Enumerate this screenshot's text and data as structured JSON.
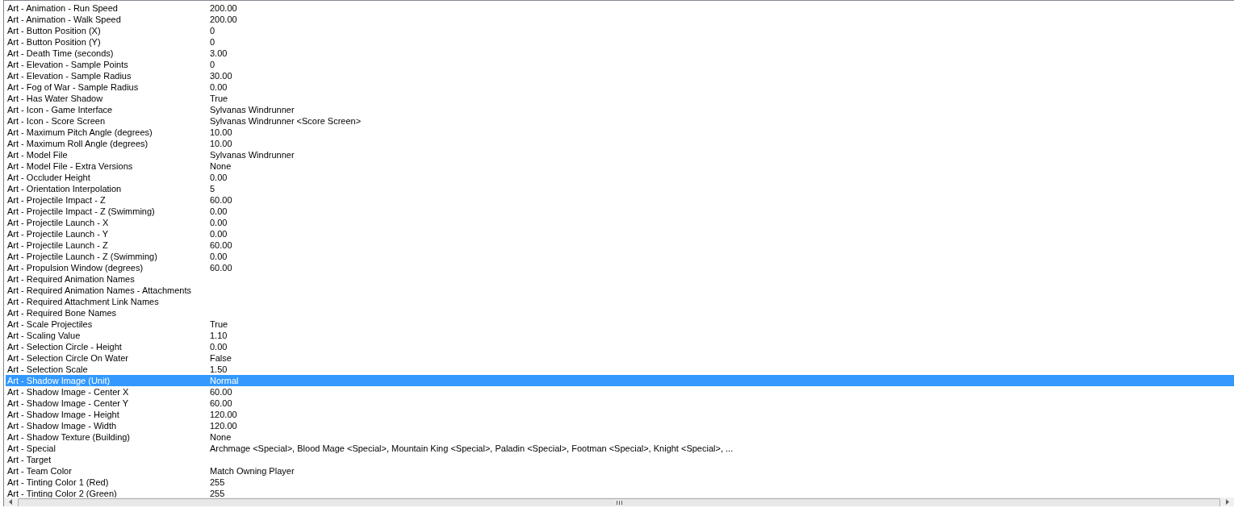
{
  "properties": [
    {
      "name": "Art - Animation - Run Speed",
      "value": "200.00",
      "selected": false
    },
    {
      "name": "Art - Animation - Walk Speed",
      "value": "200.00",
      "selected": false
    },
    {
      "name": "Art - Button Position (X)",
      "value": "0",
      "selected": false
    },
    {
      "name": "Art - Button Position (Y)",
      "value": "0",
      "selected": false
    },
    {
      "name": "Art - Death Time (seconds)",
      "value": "3.00",
      "selected": false
    },
    {
      "name": "Art - Elevation - Sample Points",
      "value": "0",
      "selected": false
    },
    {
      "name": "Art - Elevation - Sample Radius",
      "value": "30.00",
      "selected": false
    },
    {
      "name": "Art - Fog of War - Sample Radius",
      "value": "0.00",
      "selected": false
    },
    {
      "name": "Art - Has Water Shadow",
      "value": "True",
      "selected": false
    },
    {
      "name": "Art - Icon - Game Interface",
      "value": "Sylvanas Windrunner",
      "selected": false
    },
    {
      "name": "Art - Icon - Score Screen",
      "value": "Sylvanas Windrunner <Score Screen>",
      "selected": false
    },
    {
      "name": "Art - Maximum Pitch Angle (degrees)",
      "value": "10.00",
      "selected": false
    },
    {
      "name": "Art - Maximum Roll Angle (degrees)",
      "value": "10.00",
      "selected": false
    },
    {
      "name": "Art - Model File",
      "value": "Sylvanas Windrunner",
      "selected": false
    },
    {
      "name": "Art - Model File - Extra Versions",
      "value": "None",
      "selected": false
    },
    {
      "name": "Art - Occluder Height",
      "value": "0.00",
      "selected": false
    },
    {
      "name": "Art - Orientation Interpolation",
      "value": "5",
      "selected": false
    },
    {
      "name": "Art - Projectile Impact - Z",
      "value": "60.00",
      "selected": false
    },
    {
      "name": "Art - Projectile Impact - Z (Swimming)",
      "value": "0.00",
      "selected": false
    },
    {
      "name": "Art - Projectile Launch - X",
      "value": "0.00",
      "selected": false
    },
    {
      "name": "Art - Projectile Launch - Y",
      "value": "0.00",
      "selected": false
    },
    {
      "name": "Art - Projectile Launch - Z",
      "value": "60.00",
      "selected": false
    },
    {
      "name": "Art - Projectile Launch - Z (Swimming)",
      "value": "0.00",
      "selected": false
    },
    {
      "name": "Art - Propulsion Window (degrees)",
      "value": "60.00",
      "selected": false
    },
    {
      "name": "Art - Required Animation Names",
      "selected": false
    },
    {
      "name": "Art - Required Animation Names - Attachments",
      "selected": false
    },
    {
      "name": "Art - Required Attachment Link Names",
      "selected": false
    },
    {
      "name": "Art - Required Bone Names",
      "selected": false
    },
    {
      "name": "Art - Scale Projectiles",
      "value": "True",
      "selected": false
    },
    {
      "name": "Art - Scaling Value",
      "value": "1.10",
      "selected": false
    },
    {
      "name": "Art - Selection Circle - Height",
      "value": "0.00",
      "selected": false
    },
    {
      "name": "Art - Selection Circle On Water",
      "value": "False",
      "selected": false
    },
    {
      "name": "Art - Selection Scale",
      "value": "1.50",
      "selected": false
    },
    {
      "name": "Art - Shadow Image (Unit)",
      "value": "Normal",
      "selected": true
    },
    {
      "name": "Art - Shadow Image - Center X",
      "value": "60.00",
      "selected": false
    },
    {
      "name": "Art - Shadow Image - Center Y",
      "value": "60.00",
      "selected": false
    },
    {
      "name": "Art - Shadow Image - Height",
      "value": "120.00",
      "selected": false
    },
    {
      "name": "Art - Shadow Image - Width",
      "value": "120.00",
      "selected": false
    },
    {
      "name": "Art - Shadow Texture (Building)",
      "value": "None",
      "selected": false
    },
    {
      "name": "Art - Special",
      "value": "Archmage <Special>, Blood Mage <Special>, Mountain King <Special>, Paladin <Special>, Footman <Special>, Knight <Special>, ...",
      "selected": false
    },
    {
      "name": "Art - Target",
      "selected": false
    },
    {
      "name": "Art - Team Color",
      "value": "Match Owning Player",
      "selected": false
    },
    {
      "name": "Art - Tinting Color 1 (Red)",
      "value": "255",
      "selected": false
    },
    {
      "name": "Art - Tinting Color 2 (Green)",
      "value": "255",
      "selected": false
    }
  ]
}
